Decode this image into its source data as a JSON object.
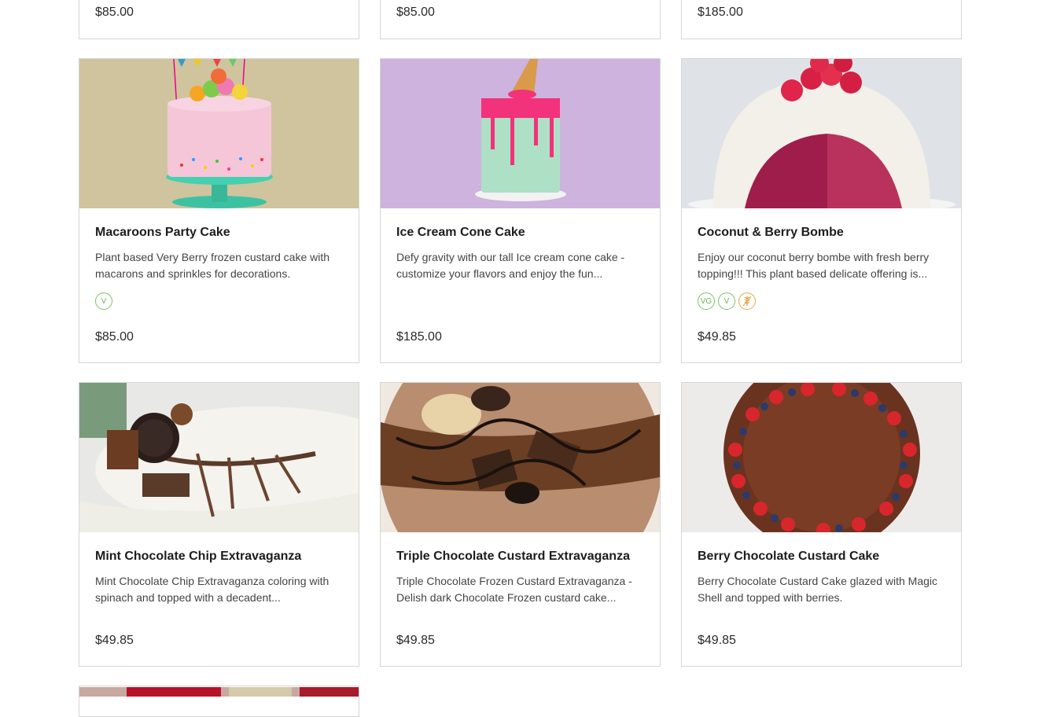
{
  "top_row": [
    {
      "price": "$85.00"
    },
    {
      "price": "$85.00"
    },
    {
      "price": "$185.00"
    }
  ],
  "products": [
    {
      "title": "Macaroons Party Cake",
      "description": "Plant based Very Berry frozen custard cake with macarons and sprinkles for decorations.",
      "price": "$85.00",
      "badges": [
        "V"
      ]
    },
    {
      "title": "Ice Cream Cone Cake",
      "description": "Defy gravity with our tall Ice cream cone cake - customize your flavors and enjoy the fun...",
      "price": "$185.00",
      "badges": []
    },
    {
      "title": "Coconut & Berry Bombe",
      "description": "Enjoy our coconut berry bombe with fresh berry topping!!! This plant based delicate offering is...",
      "price": "$49.85",
      "badges": [
        "VG",
        "V",
        "gluten-free-icon"
      ]
    },
    {
      "title": "Mint Chocolate Chip Extravaganza",
      "description": "Mint Chocolate Chip Extravaganza coloring with spinach and topped with a decadent...",
      "price": "$49.85",
      "badges": []
    },
    {
      "title": "Triple Chocolate Custard Extravaganza",
      "description": "Triple Chocolate Frozen Custard Extravaganza - Delish dark Chocolate Frozen custard cake...",
      "price": "$49.85",
      "badges": []
    },
    {
      "title": "Berry Chocolate Custard Cake",
      "description": "Berry Chocolate Custard Cake glazed with Magic Shell and topped with berries.",
      "price": "$49.85",
      "badges": []
    }
  ],
  "badge_colors": {
    "green": "#7bc16a",
    "orange": "#e5a646"
  }
}
